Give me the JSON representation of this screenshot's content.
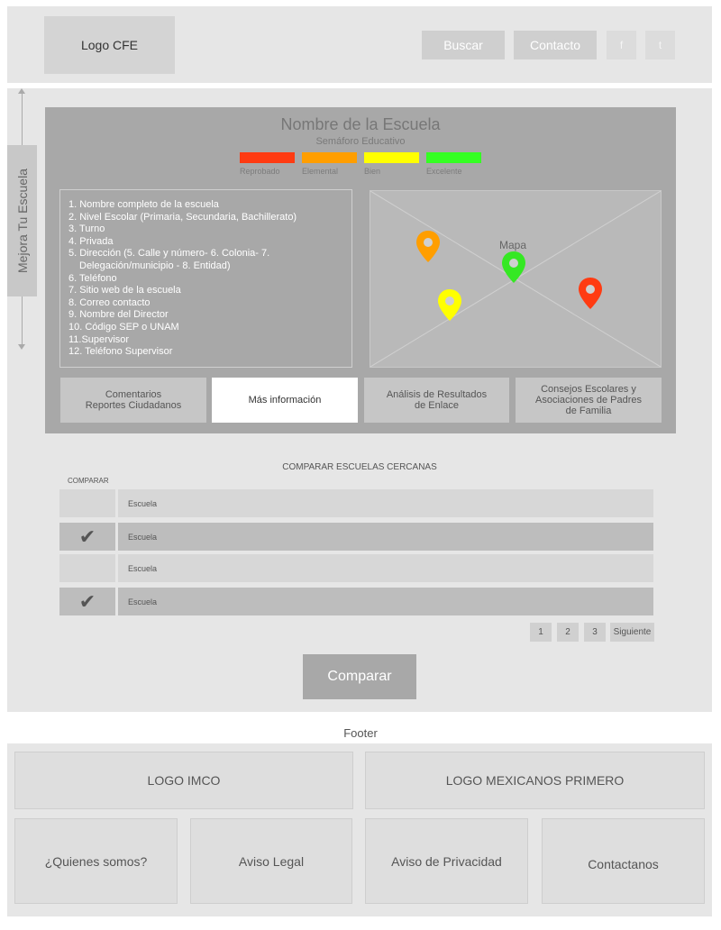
{
  "header": {
    "logo": "Logo CFE",
    "buscar": "Buscar",
    "contacto": "Contacto",
    "facebook": "f",
    "twitter": "t"
  },
  "sidebar": {
    "label": "Mejora Tu Escuela"
  },
  "school": {
    "name": "Nombre de la Escuela",
    "semaforo": "Semáforo Educativo",
    "levels": [
      {
        "label": "Reprobado",
        "color": "#ff3b12"
      },
      {
        "label": "Elemental",
        "color": "#ff9e00"
      },
      {
        "label": "Bien",
        "color": "#ffff00"
      },
      {
        "label": "Excelente",
        "color": "#35ff23"
      }
    ],
    "info": [
      "1. Nombre completo de la escuela",
      "2. Nivel Escolar (Primaria, Secundaria, Bachillerato)",
      "3. Turno",
      "4. Privada",
      "5. Dirección (5. Calle y número- 6. Colonia- 7.",
      "   Delegación/municipio - 8. Entidad)",
      "6. Teléfono",
      "7. Sitio web de la escuela",
      "8. Correo contacto",
      "9. Nombre del Director",
      "10. Código SEP o UNAM",
      "11.Supervisor",
      "12. Teléfono Supervisor"
    ],
    "map_label": "Mapa",
    "tabs": [
      {
        "label": "Comentarios\nReportes Ciudadanos"
      },
      {
        "label": "Más información"
      },
      {
        "label": "Análisis de Resultados\nde Enlace"
      },
      {
        "label": "Consejos Escolares y\nAsociaciones de Padres\nde Familia"
      }
    ]
  },
  "compare": {
    "title": "COMPARAR ESCUELAS CERCANAS",
    "column": "COMPARAR",
    "rows": [
      {
        "name": "Escuela",
        "checked": false
      },
      {
        "name": "Escuela",
        "checked": true
      },
      {
        "name": "Escuela",
        "checked": false
      },
      {
        "name": "Escuela",
        "checked": true
      }
    ],
    "check_glyph": "✔",
    "pages": [
      "1",
      "2",
      "3"
    ],
    "next": "Siguiente",
    "button": "Comparar"
  },
  "footer": {
    "label": "Footer",
    "logo_imco": "LOGO IMCO",
    "logo_mexicanos": "LOGO MEXICANOS PRIMERO",
    "quienes": "¿Quienes somos?",
    "aviso_legal": "Aviso Legal",
    "aviso_privacidad": "Aviso de Privacidad",
    "contactanos": "Contactanos"
  }
}
